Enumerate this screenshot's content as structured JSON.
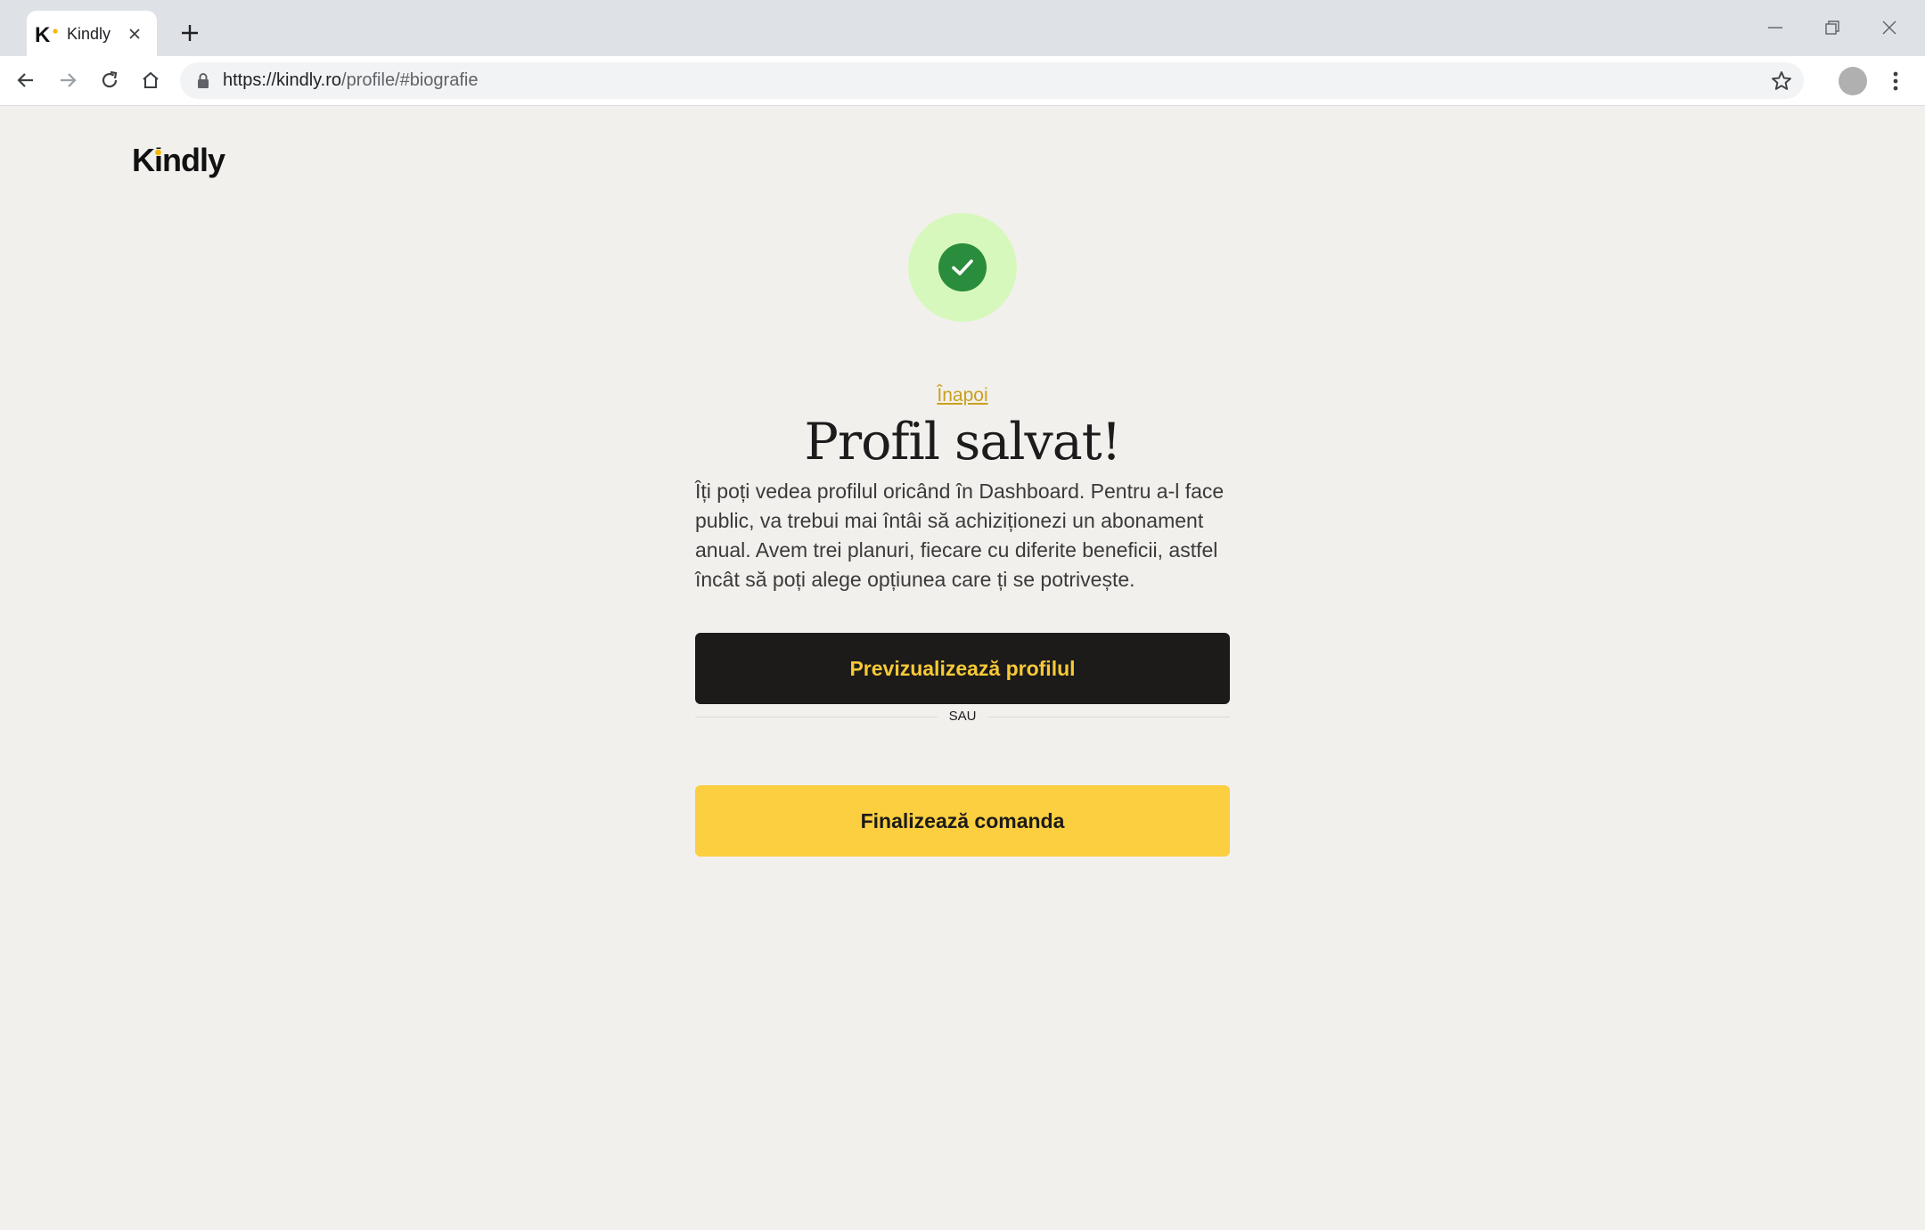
{
  "browser": {
    "tab_title": "Kindly",
    "url_host": "https://kindly.ro",
    "url_path": "/profile/#biografie"
  },
  "page": {
    "logo_text": "Kindly",
    "back_link": "Înapoi",
    "title": "Profil salvat!",
    "description": "Îți poți vedea profilul oricând în Dashboard. Pentru a-l face public, va trebui mai întâi să achiziționezi un abonament anual. Avem trei planuri, fiecare cu diferite beneficii, astfel încât să poți alege opțiunea care ți se potrivește.",
    "preview_button": "Previzualizează profilul",
    "divider_text": "SAU",
    "finalize_button": "Finalizează comanda"
  },
  "colors": {
    "background": "#f2f0ed",
    "accent_yellow": "#fbcf3f",
    "dark": "#1c1b19",
    "success_green": "#2a8c3d",
    "success_light": "#d7f8bd"
  }
}
